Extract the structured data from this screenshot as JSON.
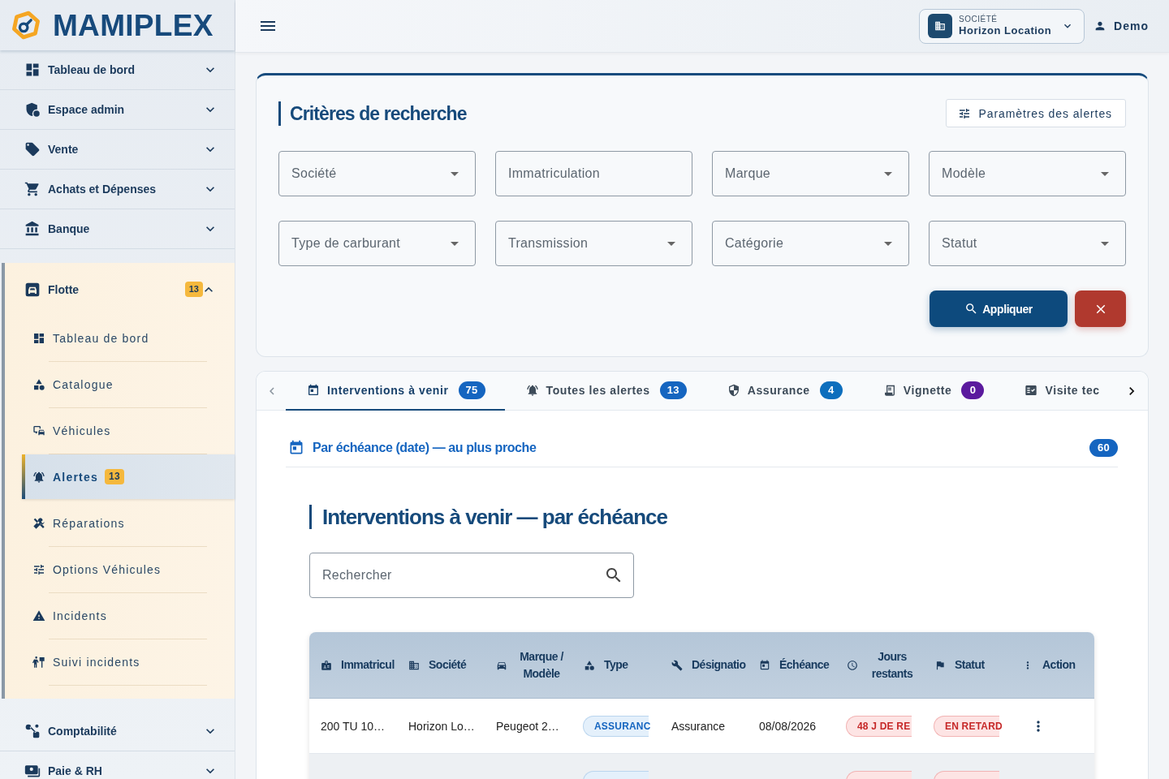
{
  "sidebar": {
    "logo": "MAMIPLEX",
    "items": [
      {
        "label": "Tableau de bord",
        "expanded": false
      },
      {
        "label": "Espace admin",
        "expanded": false
      },
      {
        "label": "Vente",
        "expanded": false
      },
      {
        "label": "Achats et Dépenses",
        "expanded": false
      },
      {
        "label": "Banque",
        "expanded": false
      },
      {
        "label": "Flotte",
        "badge": "13",
        "expanded": true,
        "children": [
          {
            "label": "Tableau de bord",
            "selected": false
          },
          {
            "label": "Catalogue",
            "selected": false
          },
          {
            "label": "Véhicules",
            "selected": false
          },
          {
            "label": "Alertes",
            "badge": "13",
            "selected": true
          },
          {
            "label": "Réparations",
            "selected": false
          },
          {
            "label": "Options Véhicules",
            "selected": false
          },
          {
            "label": "Incidents",
            "selected": false
          },
          {
            "label": "Suivi incidents",
            "selected": false
          }
        ]
      },
      {
        "label": "Comptabilité",
        "expanded": false
      },
      {
        "label": "Paie & RH",
        "expanded": false
      }
    ]
  },
  "header": {
    "company": {
      "label": "SOCIÉTÉ",
      "name": "Horizon Location"
    },
    "user": "Demo"
  },
  "search_criteria": {
    "title": "Critères de recherche",
    "settings_button": "Paramètres des alertes",
    "fields": [
      {
        "placeholder": "Société",
        "kind": "select"
      },
      {
        "placeholder": "Immatriculation",
        "kind": "text"
      },
      {
        "placeholder": "Marque",
        "kind": "select"
      },
      {
        "placeholder": "Modèle",
        "kind": "select"
      },
      {
        "placeholder": "Type de carburant",
        "kind": "select"
      },
      {
        "placeholder": "Transmission",
        "kind": "select"
      },
      {
        "placeholder": "Catégorie",
        "kind": "select"
      },
      {
        "placeholder": "Statut",
        "kind": "select"
      }
    ],
    "apply_button": "Appliquer"
  },
  "tabs": [
    {
      "label": "Interventions à venir",
      "count": "75",
      "color": "#1565c0",
      "selected": true
    },
    {
      "label": "Toutes les alertes",
      "count": "13",
      "color": "#1565c0",
      "selected": false
    },
    {
      "label": "Assurance",
      "count": "4",
      "color": "#0d6ebd",
      "selected": false
    },
    {
      "label": "Vignette",
      "count": "0",
      "color": "#5b1a9e",
      "selected": false
    },
    {
      "label": "Visite tec",
      "selected": false
    }
  ],
  "sort_group": {
    "title": "Par échéance (date) — au plus proche",
    "count": "60"
  },
  "interventions": {
    "title": "Interventions à venir — par échéance",
    "search": {
      "placeholder": "Rechercher"
    },
    "table": {
      "columns": [
        "Immatricul",
        "Société",
        "Marque / Modèle",
        "Type",
        "Désignatio",
        "Échéance",
        "Jours restants",
        "Statut",
        "Action"
      ],
      "rows": [
        {
          "immatriculation": "200 TU 10…",
          "societe": "Horizon Lo…",
          "marque_modele": "Peugeot 2…",
          "type": "ASSURANC",
          "designation": "Assurance",
          "echeance": "08/08/2026",
          "jours_restants": "48 J DE RE",
          "statut": "EN RETARD"
        }
      ]
    }
  }
}
